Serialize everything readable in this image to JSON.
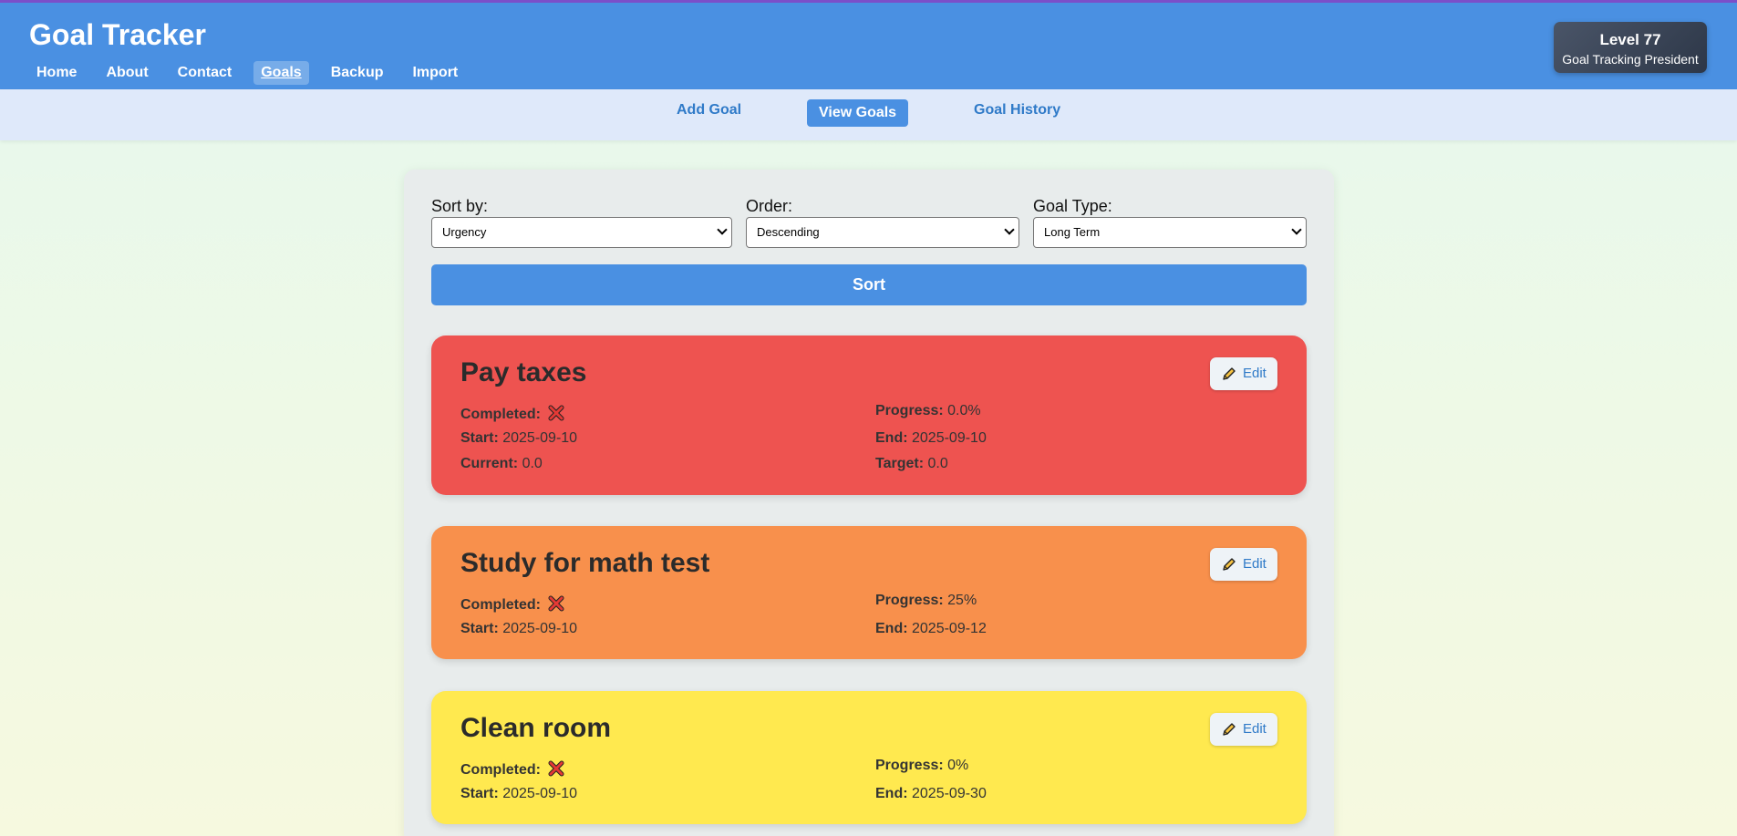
{
  "header": {
    "app_title": "Goal Tracker",
    "nav": [
      "Home",
      "About",
      "Contact",
      "Goals",
      "Backup",
      "Import"
    ],
    "active_nav": "Goals",
    "level": "Level 77",
    "rank": "Goal Tracking President"
  },
  "subnav": {
    "items": [
      "Add Goal",
      "View Goals",
      "Goal History"
    ],
    "active": "View Goals"
  },
  "filters": {
    "sort_by_label": "Sort by:",
    "sort_by_value": "Urgency",
    "order_label": "Order:",
    "order_value": "Descending",
    "goal_type_label": "Goal Type:",
    "goal_type_value": "Long Term",
    "sort_button": "Sort"
  },
  "labels": {
    "completed": "Completed:",
    "progress": "Progress:",
    "start": "Start:",
    "end": "End:",
    "current": "Current:",
    "target": "Target:",
    "edit": "Edit"
  },
  "goals": [
    {
      "title": "Pay taxes",
      "color": "#ee5350",
      "completed": false,
      "progress": "0.0%",
      "start": "2025-09-10",
      "end": "2025-09-10",
      "current": "0.0",
      "target": "0.0"
    },
    {
      "title": "Study for math test",
      "color": "#f8904c",
      "completed": false,
      "progress": "25%",
      "start": "2025-09-10",
      "end": "2025-09-12"
    },
    {
      "title": "Clean room",
      "color": "#ffe94f",
      "completed": false,
      "progress": "0%",
      "start": "2025-09-10",
      "end": "2025-09-30"
    }
  ],
  "colors": {
    "header_bg": "#4a90e2",
    "accent": "#4a90e2",
    "subnav_bg": "#dfe9fa",
    "incomplete_mark": "#d32f2f"
  },
  "icons": [
    "pencil-icon",
    "x-mark-icon",
    "chevron-down-icon"
  ]
}
